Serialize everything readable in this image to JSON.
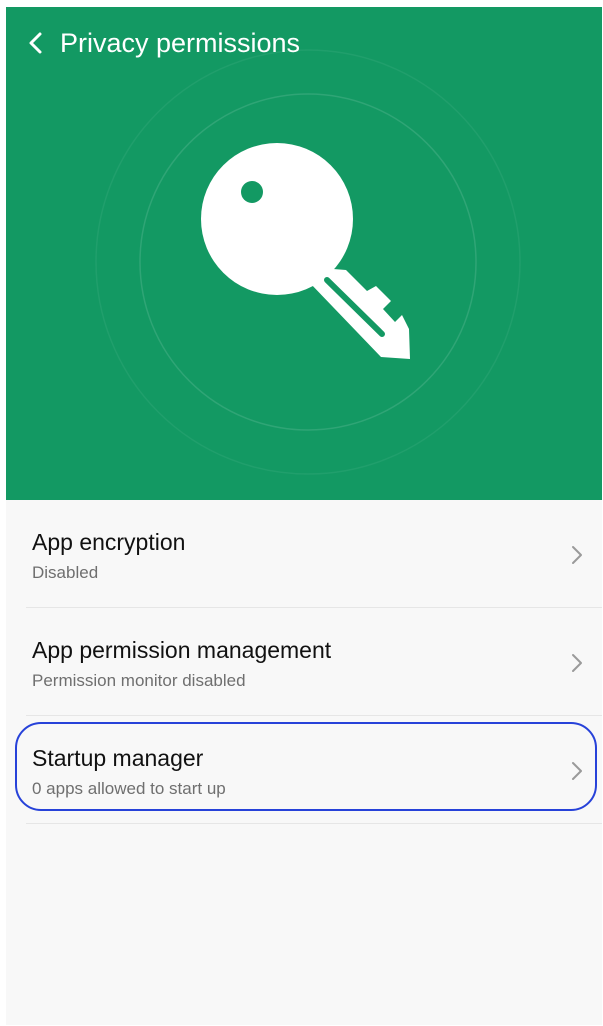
{
  "header": {
    "title": "Privacy permissions",
    "back_icon": "chevron-left-icon",
    "background_color": "#139963",
    "hero_icon": "key-icon"
  },
  "list": {
    "items": [
      {
        "title": "App encryption",
        "subtitle": "Disabled",
        "icon": "chevron-right-icon"
      },
      {
        "title": "App permission management",
        "subtitle": "Permission monitor disabled",
        "icon": "chevron-right-icon"
      },
      {
        "title": "Startup manager",
        "subtitle": "0 apps allowed to start up",
        "icon": "chevron-right-icon",
        "highlighted": true
      }
    ]
  },
  "colors": {
    "accent_green": "#139963",
    "highlight_border": "#2742d9",
    "list_background": "#f8f8f8"
  }
}
